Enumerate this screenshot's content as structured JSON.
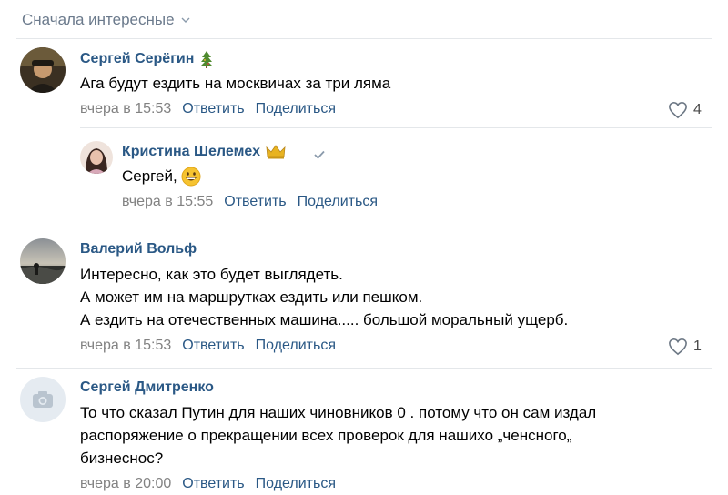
{
  "sort": {
    "label": "Сначала интересные"
  },
  "comments": [
    {
      "author": "Сергей Серёгин",
      "author_icon": "christmas-tree-icon",
      "lines": [
        "Ага будут ездить на москвичах за три ляма"
      ],
      "date": "вчера в 15:53",
      "reply_label": "Ответить",
      "share_label": "Поделиться",
      "likes": "4"
    },
    {
      "author": "Кристина Шелемех",
      "author_icon": "crown-icon",
      "lines": [
        "Сергей, "
      ],
      "date": "вчера в 15:55",
      "reply_label": "Ответить",
      "share_label": "Поделиться"
    },
    {
      "author": "Валерий Вольф",
      "lines": [
        "Интересно, как это будет выглядеть.",
        "А может им на маршрутках ездить или пешком.",
        "А ездить на отечественных машина..... большой моральный ущерб."
      ],
      "date": "вчера в 15:53",
      "reply_label": "Ответить",
      "share_label": "Поделиться",
      "likes": "1"
    },
    {
      "author": "Сергей Дмитренко",
      "lines": [
        "То что сказал Путин для наших чиновников 0 . потому что он сам издал",
        "распоряжение о прекращении всех проверок для нашихо „ченсного„",
        "бизнеснос?"
      ],
      "date": "вчера в 20:00",
      "reply_label": "Ответить",
      "share_label": "Поделиться"
    }
  ],
  "colors": {
    "link": "#2a5885",
    "muted": "#828282",
    "sort": "#6b7a8c"
  }
}
